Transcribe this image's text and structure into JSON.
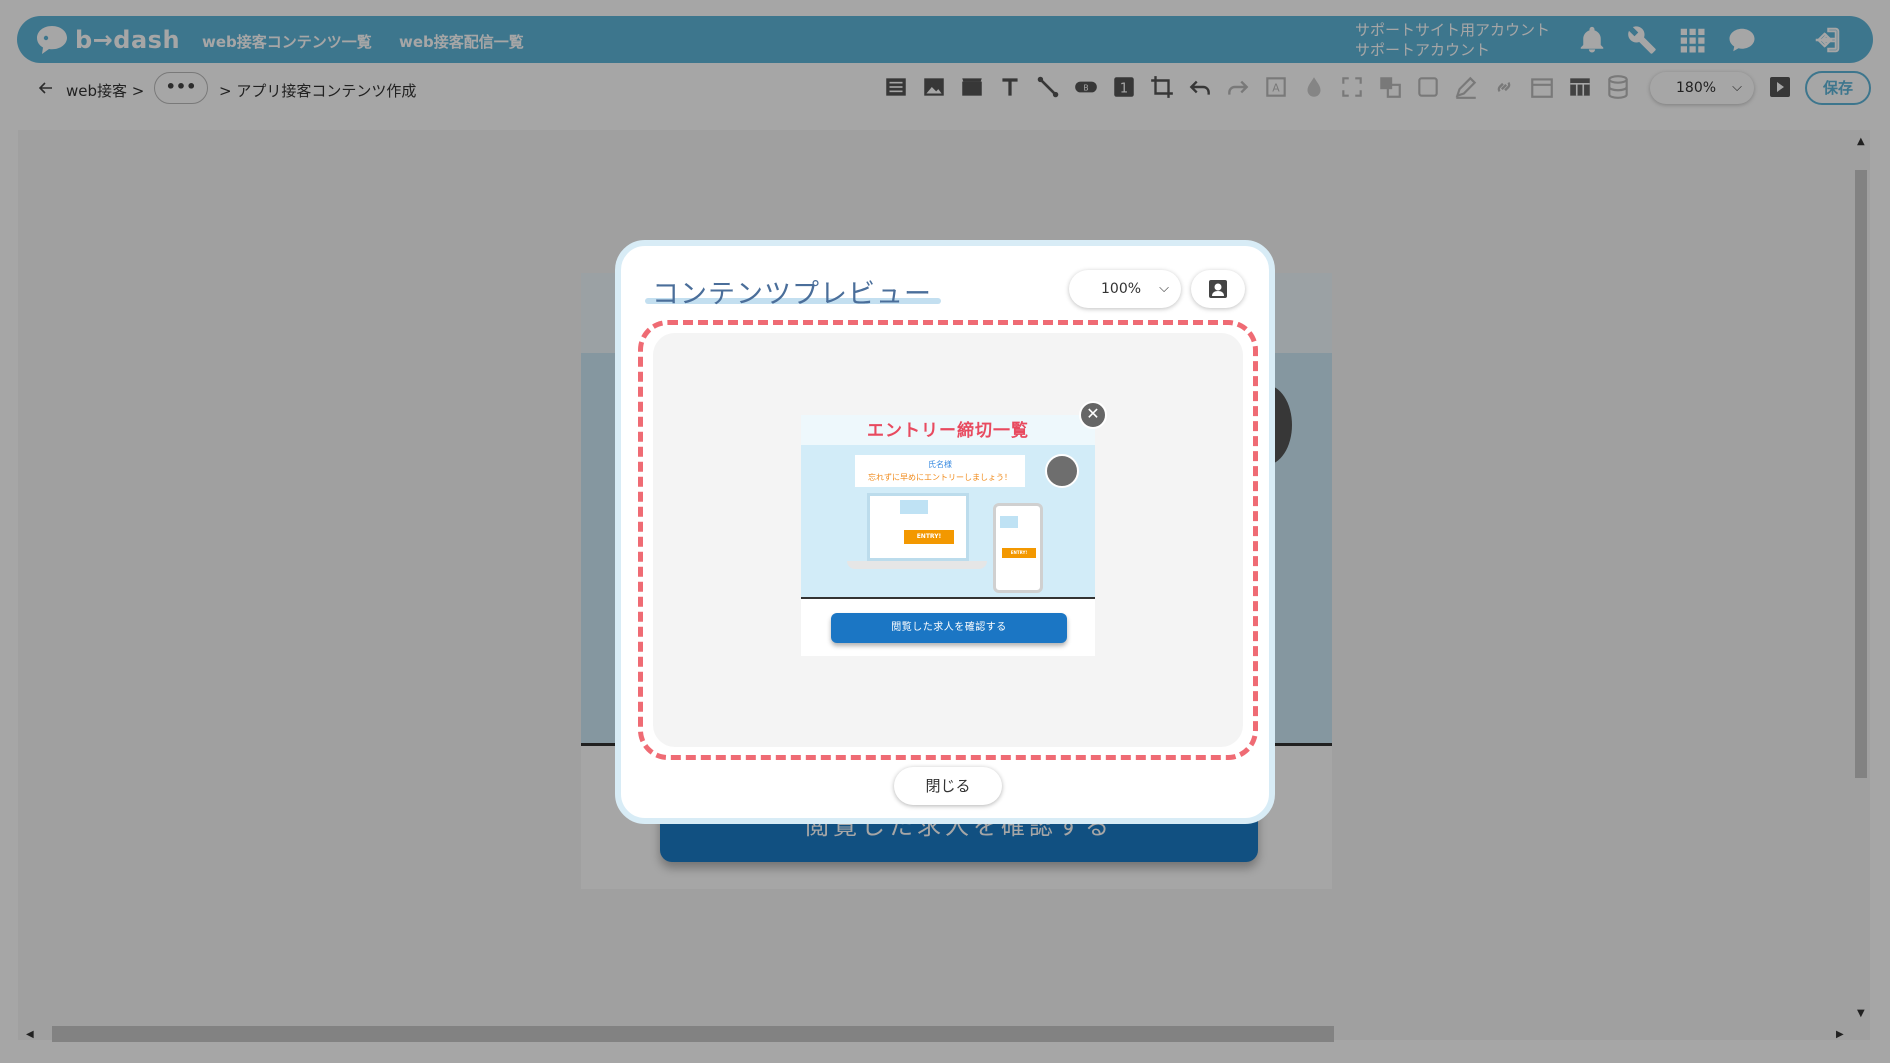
{
  "header": {
    "logo_text": "b→dash",
    "nav": [
      "web接客コンテンツ一覧",
      "web接客配信一覧"
    ],
    "account_line1": "サポートサイト用アカウント",
    "account_line2": "サポートアカウント",
    "icons": [
      "bell-icon",
      "wrench-icon",
      "apps-grid-icon",
      "chat-icon",
      "logout-icon"
    ]
  },
  "toolbar": {
    "back_crumb": "web接客 >",
    "more": "•••",
    "current_crumb": "> アプリ接客コンテンツ作成",
    "zoom": "180%",
    "save_label": "保存",
    "tools": [
      "list-icon",
      "image-icon",
      "video-icon",
      "text-icon",
      "line-icon",
      "button-icon",
      "number-icon",
      "crop-icon",
      "undo-icon",
      "redo-icon",
      "frame-icon",
      "drop-icon",
      "expand-icon",
      "layer-icon",
      "square-icon",
      "pen-icon",
      "link-icon",
      "calendar-icon",
      "table-icon",
      "database-icon"
    ],
    "number_label": "1",
    "button_label": "B"
  },
  "canvas": {
    "bg_button_label": "閲覧した求人を確認する"
  },
  "modal": {
    "title": "コンテンツプレビュー",
    "zoom": "100%",
    "close_label": "閉じる",
    "popup": {
      "title": "エントリー締切一覧",
      "name_line": "氏名様",
      "message_line": "忘れずに早めにエントリーしましょう！",
      "entry_label": "ENTRY!",
      "cta_label": "閲覧した求人を確認する",
      "close_glyph": "✕"
    }
  },
  "colors": {
    "header_bg": "#5fb5d9",
    "accent_red": "#ef6b74",
    "cta_blue": "#1b76c4",
    "entry_orange": "#f39800"
  }
}
